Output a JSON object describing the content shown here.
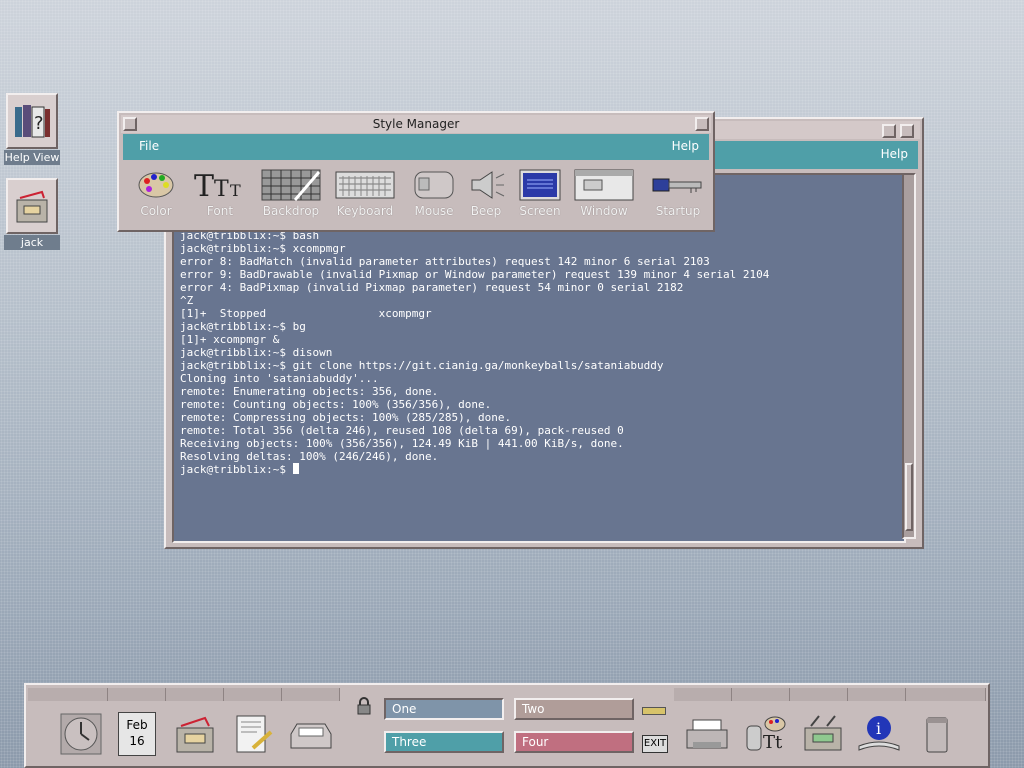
{
  "desktop_icons": [
    {
      "label": "Help View",
      "icon": "help-books-icon"
    },
    {
      "label": "jack",
      "icon": "home-folder-icon"
    }
  ],
  "terminal": {
    "menu_help": "Help",
    "tilde_lines": [
      "~",
      "~",
      "~"
    ],
    "output": "\".bashrc\" 2L, 46C written\njack@tribblix:~$ bash\njack@tribblix:~$ xcompmgr\nerror 8: BadMatch (invalid parameter attributes) request 142 minor 6 serial 2103\nerror 9: BadDrawable (invalid Pixmap or Window parameter) request 139 minor 4 serial 2104\nerror 4: BadPixmap (invalid Pixmap parameter) request 54 minor 0 serial 2182\n^Z\n[1]+  Stopped                 xcompmgr\njack@tribblix:~$ bg\n[1]+ xcompmgr &\njack@tribblix:~$ disown\njack@tribblix:~$ git clone https://git.cianig.ga/monkeyballs/sataniabuddy\nCloning into 'sataniabuddy'...\nremote: Enumerating objects: 356, done.\nremote: Counting objects: 100% (356/356), done.\nremote: Compressing objects: 100% (285/285), done.\nremote: Total 356 (delta 246), reused 108 (delta 69), pack-reused 0\nReceiving objects: 100% (356/356), 124.49 KiB | 441.00 KiB/s, done.\nResolving deltas: 100% (246/246), done.",
    "prompt": "jack@tribblix:~$ "
  },
  "style_manager": {
    "title": "Style Manager",
    "menu_file": "File",
    "menu_help": "Help",
    "tools": [
      {
        "label": "Color",
        "icon": "color-palette-icon"
      },
      {
        "label": "Font",
        "icon": "font-icon"
      },
      {
        "label": "Backdrop",
        "icon": "backdrop-icon"
      },
      {
        "label": "Keyboard",
        "icon": "keyboard-icon"
      },
      {
        "label": "Mouse",
        "icon": "mouse-icon"
      },
      {
        "label": "Beep",
        "icon": "beep-speaker-icon"
      },
      {
        "label": "Screen",
        "icon": "screen-icon"
      },
      {
        "label": "Window",
        "icon": "window-icon"
      },
      {
        "label": "Startup",
        "icon": "startup-key-icon"
      }
    ]
  },
  "front_panel": {
    "calendar_month": "Feb",
    "calendar_day": "16",
    "workspaces": [
      {
        "name": "One",
        "color": "#7f94a9"
      },
      {
        "name": "Two",
        "color": "#b09d99"
      },
      {
        "name": "Three",
        "color": "#4f9fa8"
      },
      {
        "name": "Four",
        "color": "#c06f80"
      }
    ],
    "exit_label": "EXIT"
  }
}
